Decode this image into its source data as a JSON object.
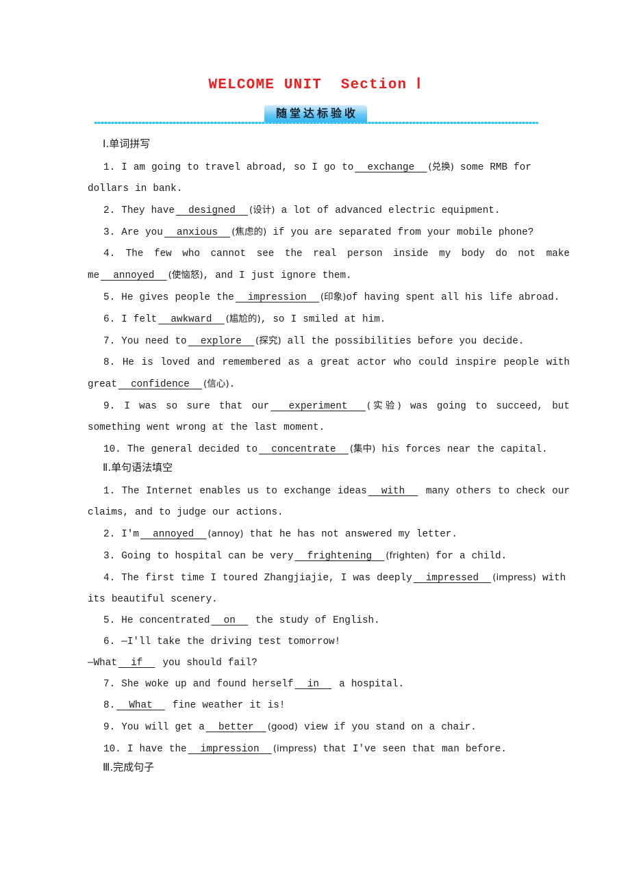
{
  "document": {
    "title": "WELCOME UNIT  Section Ⅰ",
    "banner_label": "随堂达标验收"
  },
  "sections": [
    {
      "heading": "Ⅰ.单词拼写",
      "items": [
        {
          "num": "1.",
          "before": " I am going to travel abroad, so I go to",
          "answer": "exchange",
          "hint": "(兑换)",
          "after": " some RMB for dollars in bank."
        },
        {
          "num": "2.",
          "before": " They have",
          "answer": "designed",
          "hint": "(设计)",
          "after": " a lot of advanced electric equipment."
        },
        {
          "num": "3.",
          "before": " Are you",
          "answer": "anxious",
          "hint": "(焦虑的)",
          "after": " if you are separated from your mobile phone?"
        },
        {
          "num": "4.",
          "before": " The few who cannot see the real person inside my body do not make me",
          "answer": "annoyed",
          "hint": "(使恼怒)",
          "after": ", and I just ignore them."
        },
        {
          "num": "5.",
          "before": " He gives people the",
          "answer": "impression",
          "hint": "(印象)",
          "after": "of having spent all his life abroad."
        },
        {
          "num": "6.",
          "before": " I felt",
          "answer": "awkward",
          "hint": "(尴尬的)",
          "after": ", so I smiled at him."
        },
        {
          "num": "7.",
          "before": " You need to",
          "answer": "explore",
          "hint": "(探究)",
          "after": " all the possibilities before you decide."
        },
        {
          "num": "8.",
          "before": " He is loved and remembered as a great actor who could inspire people with great",
          "answer": "confidence",
          "hint": "(信心)",
          "after": "."
        },
        {
          "num": "9.",
          "before": " I was so sure that our",
          "answer": "experiment",
          "hint": "(实验)",
          "after": " was going to succeed, but something went wrong at the last moment."
        },
        {
          "num": "10.",
          "before": " The general decided to",
          "answer": "concentrate",
          "hint": "(集中)",
          "after": " his forces near the capital."
        }
      ]
    },
    {
      "heading": "Ⅱ.单句语法填空",
      "items": [
        {
          "num": "1.",
          "before": " The Internet enables us to exchange ideas",
          "answer": "with",
          "hint": "",
          "after": " many others to check our claims, and to judge our actions."
        },
        {
          "num": "2.",
          "before": " I'm",
          "answer": "annoyed",
          "hint": "(annoy)",
          "after": " that he has not answered my letter."
        },
        {
          "num": "3.",
          "before": " Going to hospital can be very",
          "answer": "frightening",
          "hint": "(frighten)",
          "after": " for a child."
        },
        {
          "num": "4.",
          "before": " The first time I toured Zhangjiajie, I was deeply",
          "answer": "impressed",
          "hint": "(impress)",
          "after": " with its beautiful scenery."
        },
        {
          "num": "5.",
          "before": " He concentrated",
          "answer": "on",
          "hint": "",
          "after": " the study of English."
        },
        {
          "num": "6.",
          "before": " —I'll take the driving test tomorrow!",
          "answer": "",
          "hint": "",
          "after": ""
        },
        {
          "num": "",
          "before": "—What",
          "answer": "if",
          "hint": "",
          "after": " you should fail?"
        },
        {
          "num": "7.",
          "before": " She woke up and found herself",
          "answer": "in",
          "hint": "",
          "after": " a hospital."
        },
        {
          "num": "8.",
          "before": "",
          "answer": "What",
          "hint": "",
          "after": " fine weather it is!"
        },
        {
          "num": "9.",
          "before": " You will get a",
          "answer": "better",
          "hint": "(good)",
          "after": " view if you stand on a chair."
        },
        {
          "num": "10.",
          "before": " I have the",
          "answer": "impression",
          "hint": "(impress)",
          "after": " that I've seen that man before."
        }
      ]
    },
    {
      "heading": "Ⅲ.完成句子",
      "items": []
    }
  ],
  "colors": {
    "title_red": "#ee1c1c",
    "rule_cyan": "#2fc0f4",
    "badge_blue": "#37b7f0",
    "text": "#1b1b1b"
  }
}
